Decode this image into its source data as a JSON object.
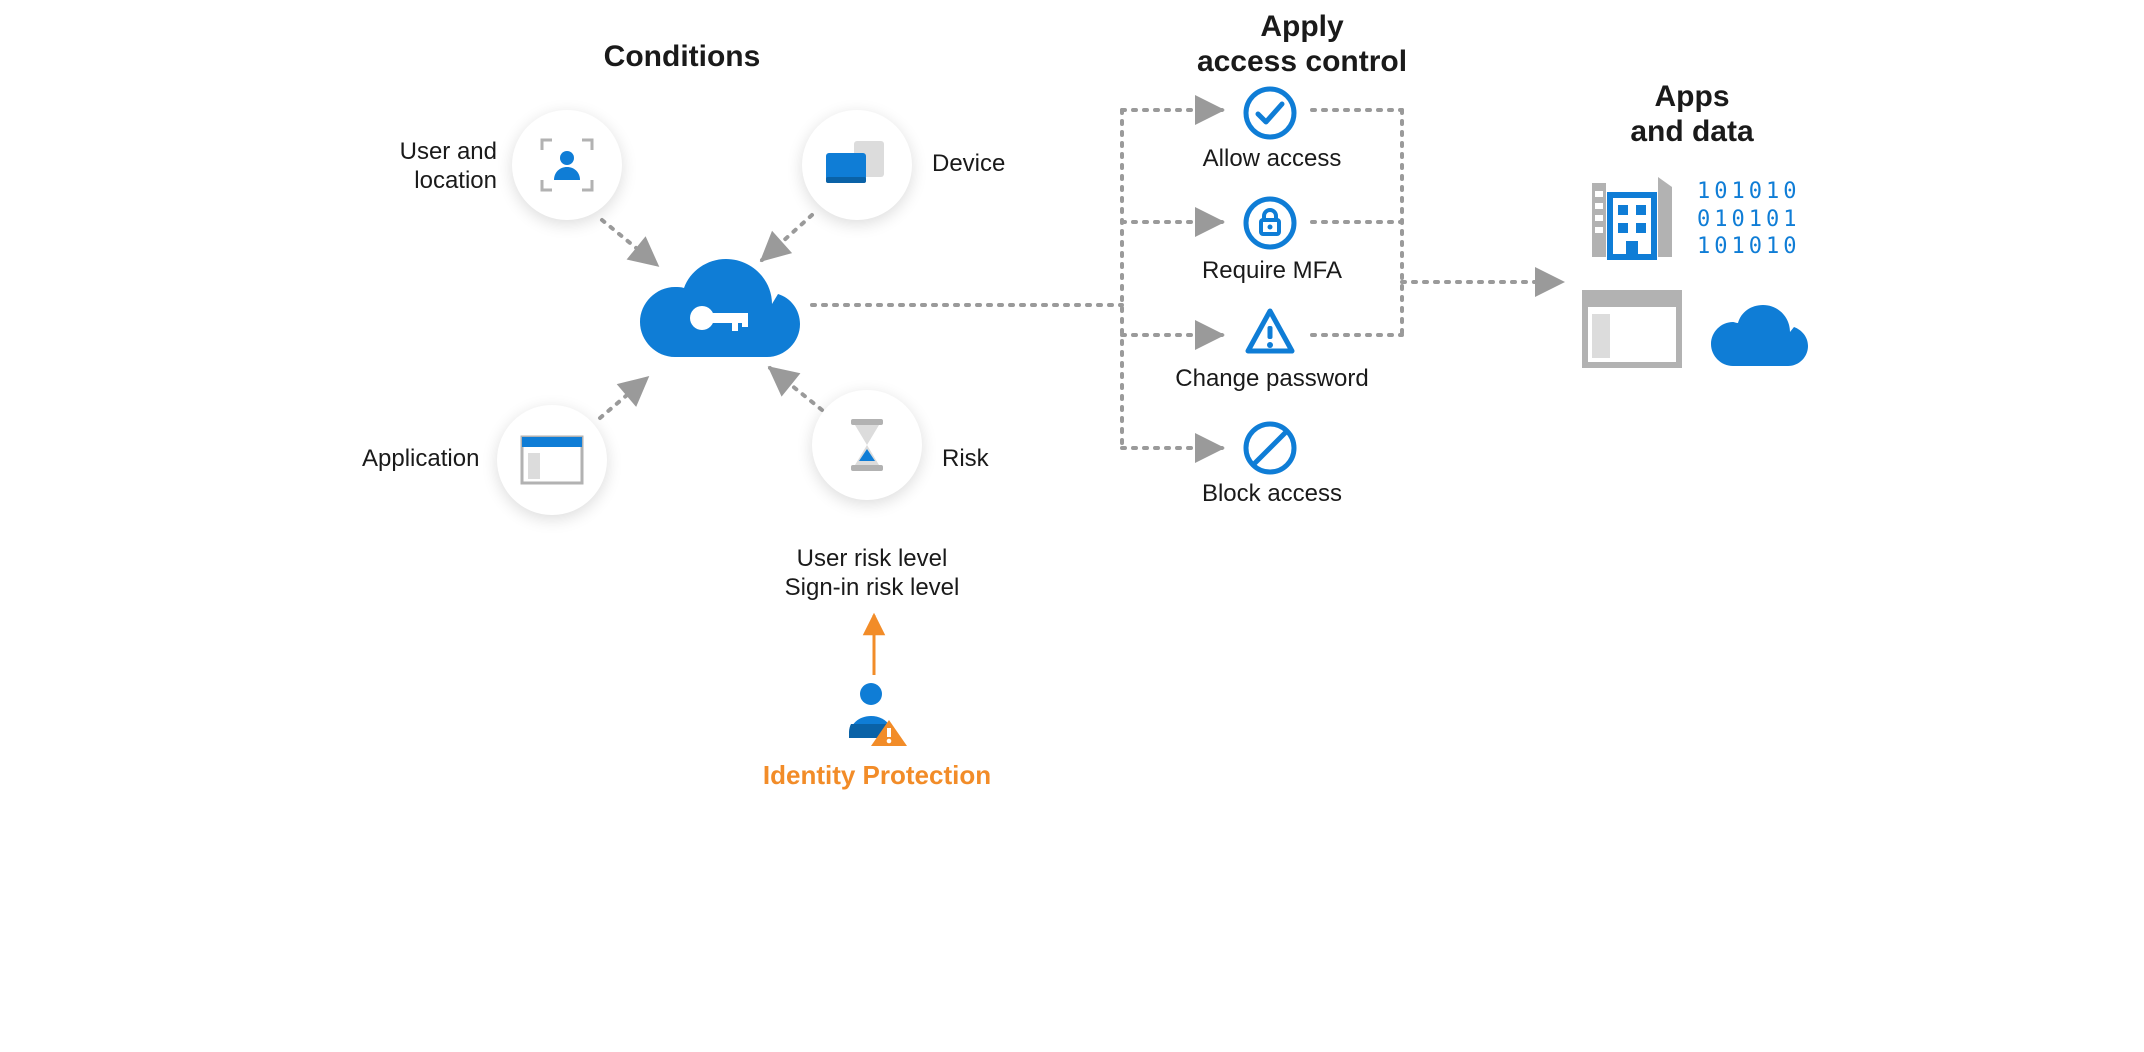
{
  "columns": {
    "conditions": {
      "title": "Conditions"
    },
    "access": {
      "title_l1": "Apply",
      "title_l2": "access control"
    },
    "apps": {
      "title_l1": "Apps",
      "title_l2": "and data"
    }
  },
  "conditions": {
    "user_location_l1": "User and",
    "user_location_l2": "location",
    "device": "Device",
    "application": "Application",
    "risk": "Risk",
    "risk_detail_l1": "User risk level",
    "risk_detail_l2": "Sign-in risk level"
  },
  "access": {
    "allow": "Allow access",
    "mfa": "Require MFA",
    "pwd": "Change password",
    "block": "Block access"
  },
  "identity_protection": "Identity Protection",
  "colors": {
    "blue": "#0f7dd6",
    "gray": "#b2b2b2",
    "dark": "#1a1a1a",
    "orange": "#f28c28"
  }
}
